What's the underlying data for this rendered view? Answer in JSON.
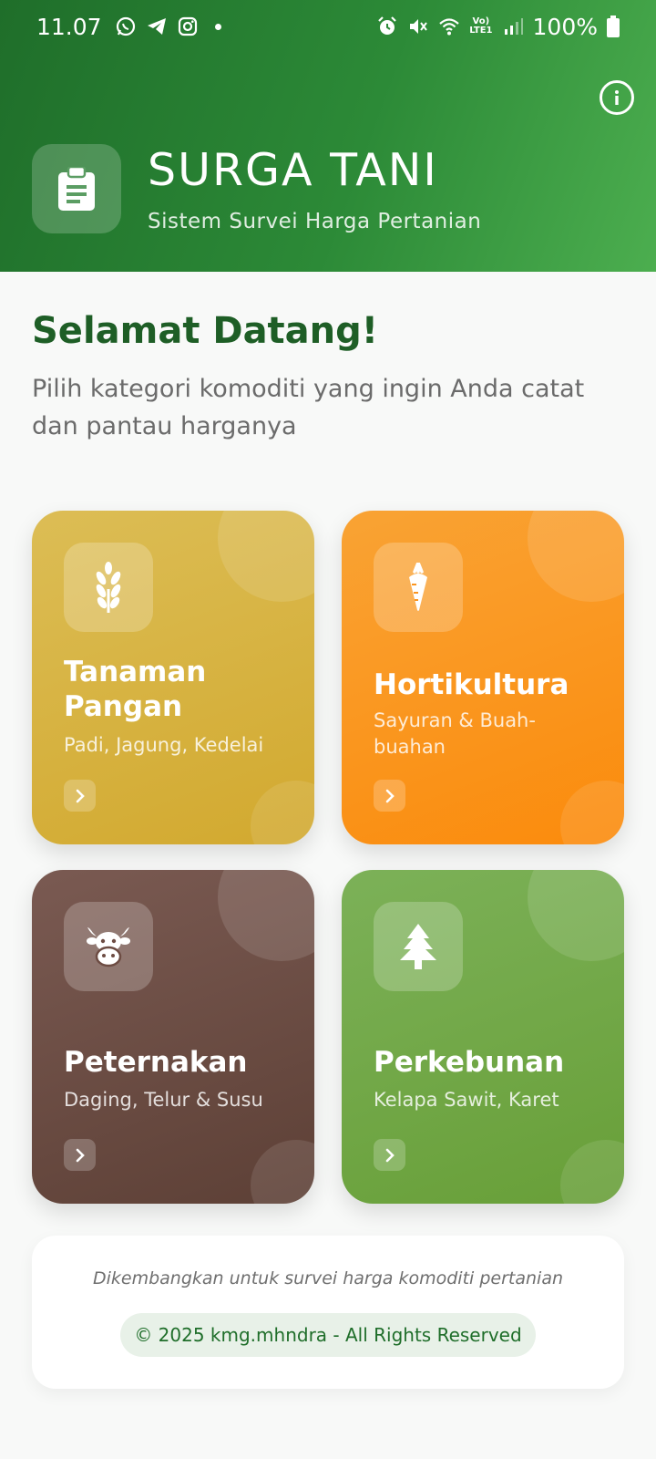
{
  "status_bar": {
    "time": "11.07",
    "signal_label": "Vo)\nLTE1",
    "battery": "100%"
  },
  "header": {
    "title": "SURGA TANI",
    "subtitle": "Sistem Survei Harga Pertanian",
    "app_icon": "clipboard-icon",
    "info_icon": "info-icon"
  },
  "welcome": {
    "title": "Selamat Datang!",
    "description": "Pilih kategori komoditi yang ingin Anda catat dan pantau harganya"
  },
  "categories": [
    {
      "title": "Tanaman\nPangan",
      "subtitle": "Padi, Jagung, Kedelai",
      "icon": "wheat-icon",
      "color": "#d6b03d"
    },
    {
      "title": "Hortikultura",
      "subtitle": "Sayuran & Buah-buahan",
      "icon": "carrot-icon",
      "color": "#fb9520"
    },
    {
      "title": "Peternakan",
      "subtitle": "Daging, Telur & Susu",
      "icon": "cow-icon",
      "color": "#6d4c43"
    },
    {
      "title": "Perkebunan",
      "subtitle": "Kelapa Sawit, Karet",
      "icon": "tree-icon",
      "color": "#71a846"
    }
  ],
  "footer": {
    "note": "Dikembangkan untuk survei harga komoditi pertanian",
    "copyright": "© 2025 kmg.mhndra - All Rights Reserved"
  },
  "colors": {
    "primary": "#2c8a37",
    "welcome_title": "#1e5e26"
  }
}
